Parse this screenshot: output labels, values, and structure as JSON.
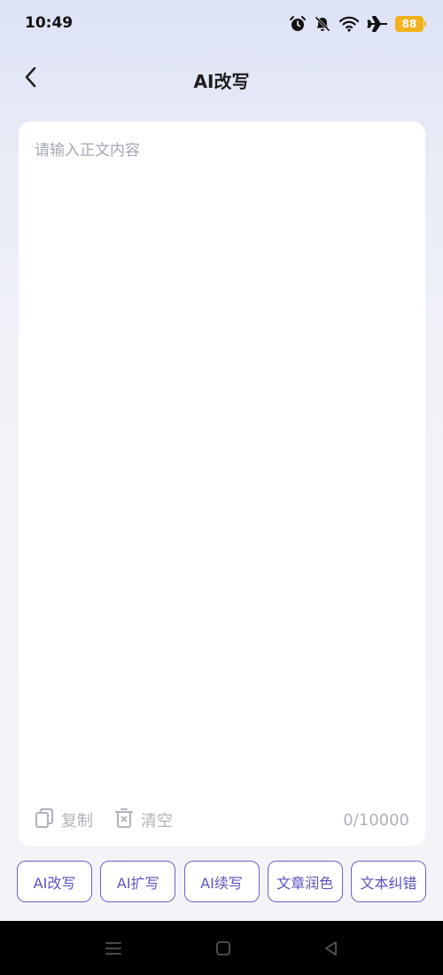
{
  "status_bar": {
    "time": "10:49",
    "battery_level": "88",
    "icons": [
      "alarm-icon",
      "bell-muted-icon",
      "wifi-icon",
      "airplane-icon",
      "battery-icon"
    ],
    "battery_color": "#f3b21c"
  },
  "header": {
    "back_icon": "chevron-left-icon",
    "title": "AI改写"
  },
  "editor": {
    "value": "",
    "placeholder": "请输入正文内容",
    "copy_label": "复制",
    "clear_label": "清空",
    "char_count": "0/10000"
  },
  "actions": [
    {
      "label": "AI改写"
    },
    {
      "label": "AI扩写"
    },
    {
      "label": "AI续写"
    },
    {
      "label": "文章润色"
    },
    {
      "label": "文本纠错"
    }
  ],
  "colors": {
    "accent": "#5b53c0",
    "placeholder": "#a3a8b4",
    "muted": "#b0b3ba"
  },
  "nav_bar": {
    "icons": [
      "menu-icon",
      "home-icon",
      "back-triangle-icon"
    ]
  }
}
